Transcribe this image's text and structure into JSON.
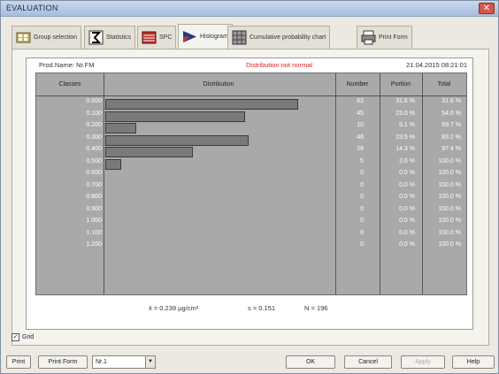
{
  "window": {
    "title": "EVALUATION",
    "close_symbol": "✕"
  },
  "tabs": [
    {
      "label": "Group selection",
      "icon": "group-selection-icon",
      "active": false
    },
    {
      "label": "Statistics",
      "icon": "statistics-icon",
      "active": false
    },
    {
      "label": "SPC",
      "icon": "spc-chart-icon",
      "active": false
    },
    {
      "label": "Histogram",
      "icon": "histogram-icon",
      "active": true
    },
    {
      "label": "Cumulative probability chart",
      "icon": "probability-chart-icon",
      "active": false
    },
    {
      "label": "Print Form",
      "icon": "print-form-icon",
      "active": false
    }
  ],
  "report": {
    "prod_name": "Prod.Name: Nr.FM",
    "status": "Distribution not normal",
    "date": "21.04.2015 08:21:01",
    "status_color": "#e02020",
    "headers": {
      "classes": "Classes",
      "distribution": "Distribution",
      "number": "Number",
      "portion": "Portion",
      "total": "Total"
    },
    "rows": [
      {
        "cls": "0.000",
        "number": "62",
        "portion": "31.6 %",
        "total": "31.6 %",
        "frac": 1.0
      },
      {
        "cls": "0.100",
        "number": "45",
        "portion": "23.0 %",
        "total": "54.6 %",
        "frac": 0.726
      },
      {
        "cls": "0.200",
        "number": "10",
        "portion": "5.1 %",
        "total": "59.7 %",
        "frac": 0.161
      },
      {
        "cls": "0.300",
        "number": "46",
        "portion": "23.5 %",
        "total": "83.2 %",
        "frac": 0.742
      },
      {
        "cls": "0.400",
        "number": "28",
        "portion": "14.3 %",
        "total": "97.4 %",
        "frac": 0.452
      },
      {
        "cls": "0.500",
        "number": "5",
        "portion": "2.6 %",
        "total": "100.0 %",
        "frac": 0.081
      },
      {
        "cls": "0.600",
        "number": "0",
        "portion": "0.0 %",
        "total": "100.0 %",
        "frac": 0
      },
      {
        "cls": "0.700",
        "number": "0",
        "portion": "0.0 %",
        "total": "100.0 %",
        "frac": 0
      },
      {
        "cls": "0.800",
        "number": "0",
        "portion": "0.0 %",
        "total": "100.0 %",
        "frac": 0
      },
      {
        "cls": "0.900",
        "number": "0",
        "portion": "0.0 %",
        "total": "100.0 %",
        "frac": 0
      },
      {
        "cls": "1.000",
        "number": "0",
        "portion": "0.0 %",
        "total": "100.0 %",
        "frac": 0
      },
      {
        "cls": "1.100",
        "number": "0",
        "portion": "0.0 %",
        "total": "100.0 %",
        "frac": 0
      },
      {
        "cls": "1.200",
        "number": "0",
        "portion": "0.0 %",
        "total": "100.0 %",
        "frac": 0
      }
    ],
    "stats": {
      "mean": "x̄ = 0.239 µg/cm²",
      "sd": "s = 0.151",
      "n": "N = 196"
    }
  },
  "grid_checkbox": {
    "label": "Grid",
    "checked": true,
    "mark": "✓"
  },
  "bottom": {
    "print": "Print",
    "print_form": "Print Form",
    "combo_value": "Nr.1",
    "combo_arrow": "▼",
    "ok": "OK",
    "cancel": "Cancel",
    "apply": "Apply",
    "help": "Help"
  }
}
